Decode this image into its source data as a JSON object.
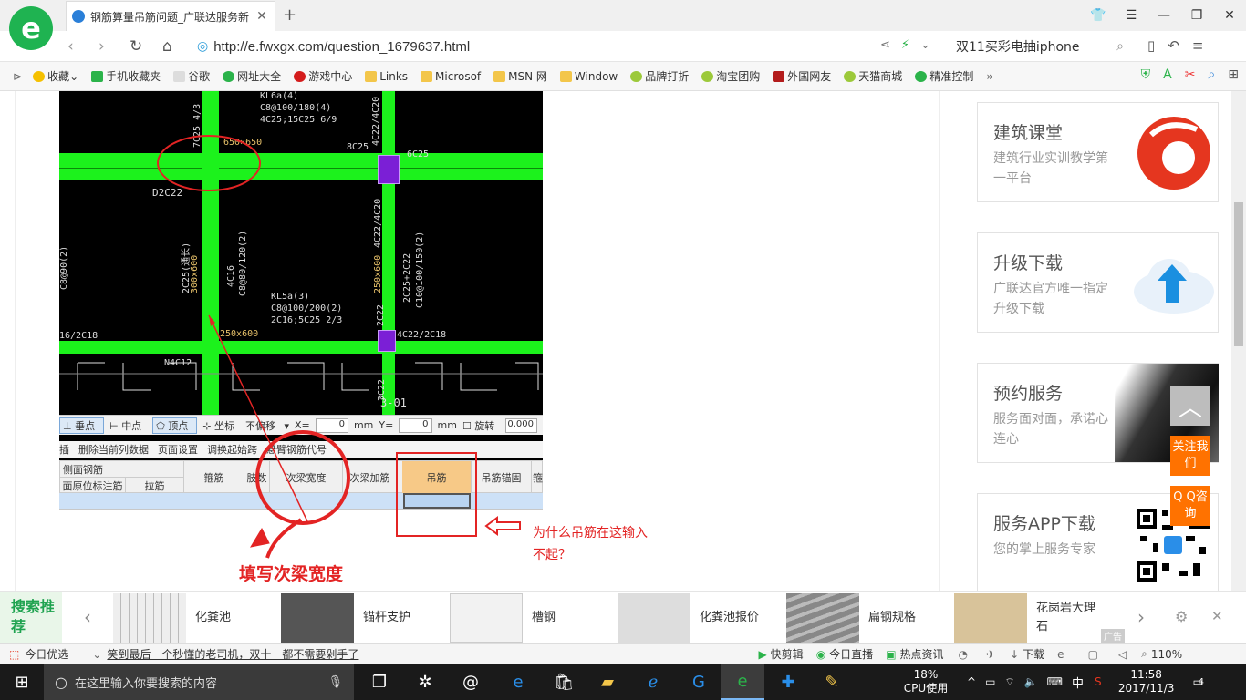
{
  "browser": {
    "tab_title": "钢筋算量吊筋问题_广联达服务新",
    "url": "http://e.fwxgx.com/question_1679637.html",
    "search_text": "双11买彩电抽iphone"
  },
  "bookmarks": [
    "收藏",
    "手机收藏夹",
    "谷歌",
    "网址大全",
    "游戏中心",
    "Links",
    "Microsof",
    "MSN 网",
    "Window",
    "品牌打折",
    "淘宝团购",
    "外国网友",
    "天猫商城",
    "精准控制"
  ],
  "cad": {
    "labels": {
      "kl6a1": "KL6a(4)",
      "kl6a2": "C8@100/180(4)",
      "kl6a3": "4C25;15C25 6/9",
      "v7c25": "7C25 4/3",
      "v4c20": "4C22/4C20",
      "s650": "650×650",
      "r8c25": "8C25",
      "r6c25": "6C25",
      "d2c22": "D2C22",
      "v4c22b": "4C22/4C20",
      "v250": "250x600",
      "v2c25": "2C25(通长)",
      "v300": "300x600",
      "v4c16": "4C16",
      "vc8": "C8@80/120(2)",
      "v2c25b": "2C25+2C22",
      "vc10": "C10@100/150(2)",
      "vleft": "C8@90(2)",
      "kl5a1": "KL5a(3)",
      "kl5a2": "C8@100/200(2)",
      "kl5a3": "2C16;5C25 2/3",
      "s250": "250x600",
      "l16": "16/2C18",
      "r4c22": "4C22/2C18",
      "n4c12": "N4C12",
      "v2c22": "2C22",
      "v3c22": "3C22",
      "pt": "3-01"
    }
  },
  "snapbar": {
    "perp": "垂点",
    "mid": "中点",
    "vertex": "顶点",
    "coord": "坐标",
    "nooffset": "不偏移",
    "x_label": "X=",
    "x_val": "0",
    "mm1": "mm",
    "y_label": "Y=",
    "y_val": "0",
    "mm2": "mm",
    "rotate": "旋转",
    "rot_val": "0.000"
  },
  "menubar": [
    "插",
    "删除当前列数据",
    "页面设置",
    "调换起始跨",
    "悬臂钢筋代号"
  ],
  "grid_headers": {
    "side_top": "侧面钢筋",
    "side_a": "面原位标注筋",
    "side_b": "拉筋",
    "stirrup": "箍筋",
    "limb": "肢数",
    "secondary_width": "次梁宽度",
    "secondary_add": "次梁加筋",
    "hanger": "吊筋",
    "hanger_anchor": "吊筋锚固",
    "more": "箍"
  },
  "annotations": {
    "fill_secondary_width": "填写次梁宽度",
    "question_line1": "为什么吊筋在这输入",
    "question_line2": "不起？"
  },
  "sidebar": [
    {
      "title": "建筑课堂",
      "desc": "建筑行业实训教学第一平台"
    },
    {
      "title": "升级下载",
      "desc": "广联达官方唯一指定升级下载"
    },
    {
      "title": "预约服务",
      "desc": "服务面对面，承诺心连心"
    },
    {
      "title": "服务APP下载",
      "desc": "您的掌上服务专家"
    }
  ],
  "float": {
    "follow": "关注我们",
    "qq": "Q Q咨询"
  },
  "recommend": {
    "tag": "搜索推荐",
    "items": [
      "化粪池",
      "锚杆支护",
      "槽钢",
      "化粪池报价",
      "扁钢规格",
      "花岗岩大理石"
    ],
    "ad": "广告"
  },
  "statusbar": {
    "today": "今日优选",
    "news": "笑到最后一个秒懂的老司机，双十一都不需要剁手了",
    "quickclip": "快剪辑",
    "live": "今日直播",
    "hot": "热点资讯",
    "download": "下载",
    "zoom": "110%"
  },
  "taskbar": {
    "search_placeholder": "在这里输入你要搜索的内容",
    "cpu_pct": "18%",
    "cpu_label": "CPU使用",
    "ime": "中",
    "time": "11:58",
    "date": "2017/11/3",
    "notif": "4"
  },
  "colors": {
    "accent_green": "#1cf21c",
    "annotation_red": "#e32424",
    "float_orange": "#ff7200"
  }
}
